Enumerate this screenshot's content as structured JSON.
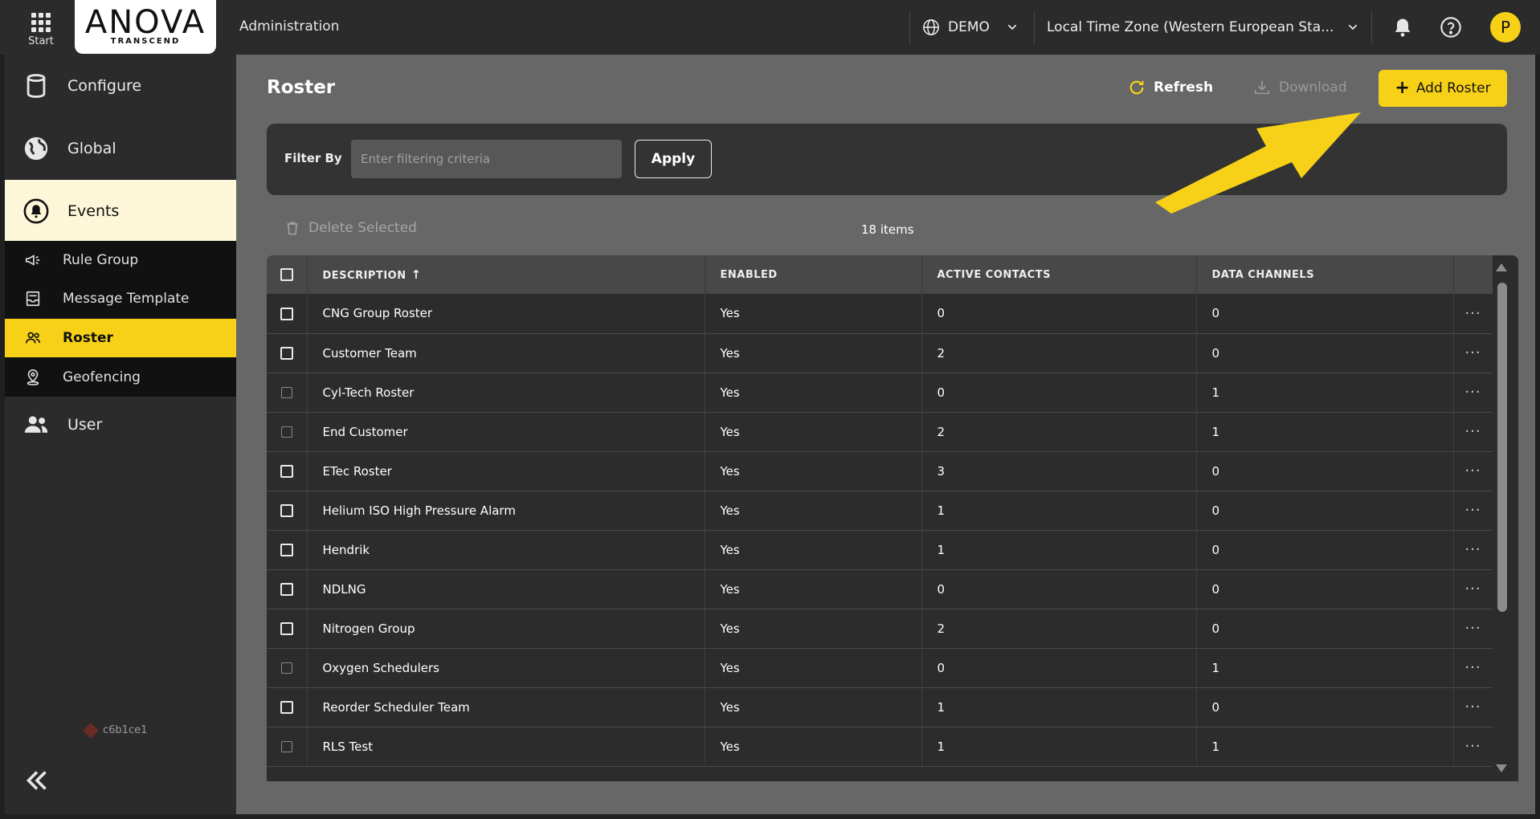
{
  "topbar": {
    "start_label": "Start",
    "logo_main": "ANOVA",
    "logo_sub": "TRANSCEND",
    "section_title": "Administration",
    "org_selector": "DEMO",
    "timezone_selector": "Local Time Zone (Western European Sta...",
    "avatar_initial": "P",
    "icons": [
      "apps-grid-icon",
      "globe-icon",
      "chevron-down-icon",
      "bell-icon",
      "help-icon"
    ]
  },
  "sidebar": {
    "main_items": [
      {
        "label": "Configure",
        "icon": "database-icon"
      },
      {
        "label": "Global",
        "icon": "globe-icon"
      },
      {
        "label": "Events",
        "icon": "alarm-bell-icon",
        "active": true
      },
      {
        "label": "User",
        "icon": "users-icon"
      }
    ],
    "sub_items": [
      {
        "label": "Rule Group",
        "icon": "megaphone-icon"
      },
      {
        "label": "Message Template",
        "icon": "template-icon"
      },
      {
        "label": "Roster",
        "icon": "roster-icon",
        "active": true
      },
      {
        "label": "Geofencing",
        "icon": "map-pin-icon"
      }
    ],
    "version": "c6b1ce1"
  },
  "page": {
    "title": "Roster",
    "refresh_label": "Refresh",
    "download_label": "Download",
    "add_label": "Add Roster"
  },
  "filter": {
    "label": "Filter By",
    "placeholder": "Enter filtering criteria",
    "value": "",
    "apply_label": "Apply"
  },
  "toolbar": {
    "delete_label": "Delete Selected",
    "item_count": "18 items"
  },
  "table": {
    "columns": [
      "DESCRIPTION",
      "ENABLED",
      "ACTIVE CONTACTS",
      "DATA CHANNELS"
    ],
    "rows": [
      {
        "description": "CNG Group Roster",
        "enabled": "Yes",
        "active_contacts": "0",
        "data_channels": "0",
        "checkbox_style": "bright"
      },
      {
        "description": "Customer Team",
        "enabled": "Yes",
        "active_contacts": "2",
        "data_channels": "0",
        "checkbox_style": "bright"
      },
      {
        "description": "Cyl-Tech Roster",
        "enabled": "Yes",
        "active_contacts": "0",
        "data_channels": "1",
        "checkbox_style": "dim"
      },
      {
        "description": "End Customer",
        "enabled": "Yes",
        "active_contacts": "2",
        "data_channels": "1",
        "checkbox_style": "dim"
      },
      {
        "description": "ETec Roster",
        "enabled": "Yes",
        "active_contacts": "3",
        "data_channels": "0",
        "checkbox_style": "bright"
      },
      {
        "description": "Helium ISO High Pressure Alarm",
        "enabled": "Yes",
        "active_contacts": "1",
        "data_channels": "0",
        "checkbox_style": "bright"
      },
      {
        "description": "Hendrik",
        "enabled": "Yes",
        "active_contacts": "1",
        "data_channels": "0",
        "checkbox_style": "bright"
      },
      {
        "description": "NDLNG",
        "enabled": "Yes",
        "active_contacts": "0",
        "data_channels": "0",
        "checkbox_style": "bright"
      },
      {
        "description": "Nitrogen Group",
        "enabled": "Yes",
        "active_contacts": "2",
        "data_channels": "0",
        "checkbox_style": "bright"
      },
      {
        "description": "Oxygen Schedulers",
        "enabled": "Yes",
        "active_contacts": "0",
        "data_channels": "1",
        "checkbox_style": "dim"
      },
      {
        "description": "Reorder Scheduler Team",
        "enabled": "Yes",
        "active_contacts": "1",
        "data_channels": "0",
        "checkbox_style": "bright"
      },
      {
        "description": "RLS Test",
        "enabled": "Yes",
        "active_contacts": "1",
        "data_channels": "1",
        "checkbox_style": "dim"
      }
    ],
    "row_action_glyph": "···"
  },
  "colors": {
    "accent": "#f7d117",
    "annotation_arrow": "#f7d117",
    "main_bg": "#676767",
    "sidebar_bg": "#2b2b2b"
  }
}
